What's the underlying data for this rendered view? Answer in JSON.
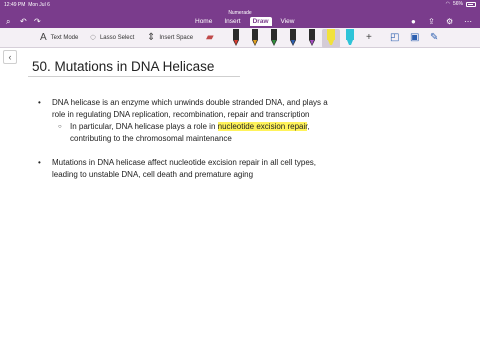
{
  "status_bar": {
    "time": "12:49 PM",
    "date": "Mon Jul 6",
    "battery": "56%"
  },
  "ribbon": {
    "app_name": "Numerade",
    "tabs": [
      {
        "label": "Home",
        "active": false
      },
      {
        "label": "Insert",
        "active": false
      },
      {
        "label": "Draw",
        "active": true
      },
      {
        "label": "View",
        "active": false
      }
    ],
    "accent_color": "#7a3c8c"
  },
  "toolbar": {
    "text_mode_label": "Text Mode",
    "lasso_label": "Lasso Select",
    "insert_space_label": "Insert Space",
    "pens": [
      "#d63b2f",
      "#e0a01e",
      "#2f8f3b",
      "#2c5fb0",
      "#a34bc0",
      "#f2e23a",
      "#2ec4d8"
    ]
  },
  "page": {
    "title": "50. Mutations in DNA Helicase"
  },
  "notes": {
    "bullet1_line1": "DNA helicase is an enzyme which unwinds double stranded DNA, and plays a",
    "bullet1_line2": "role in regulating DNA replication, recombination, repair and transcription",
    "sub1_prefix": "In particular, DNA helicase plays a role in ",
    "sub1_highlight": "nucleotide excision repair",
    "sub1_suffix": ",",
    "sub1_line2": "contributing to the chromosomal maintenance",
    "bullet2_line1": "Mutations in DNA helicase affect nucleotide excision repair in all cell types,",
    "bullet2_line2": "leading to unstable DNA, cell death and premature aging"
  }
}
